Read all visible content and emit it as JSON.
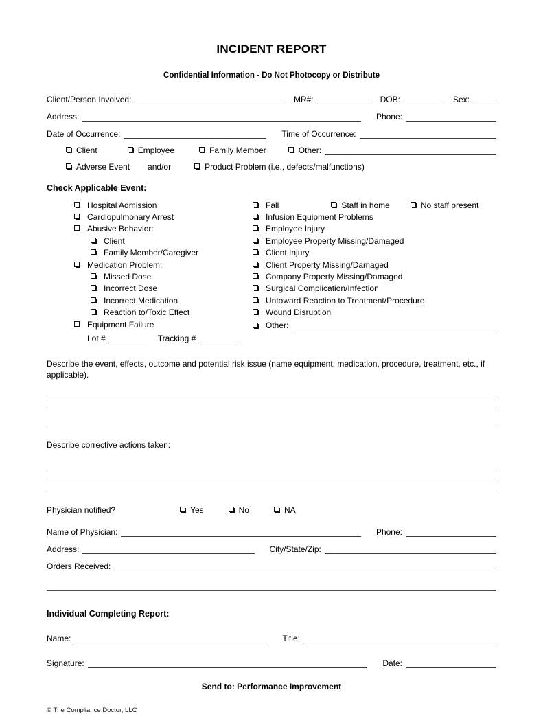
{
  "header": {
    "title": "INCIDENT REPORT",
    "subtitle": "Confidential Information - Do Not Photocopy or Distribute"
  },
  "identity": {
    "client_label": "Client/Person Involved:",
    "mr_label": "MR#:",
    "dob_label": "DOB:",
    "sex_label": "Sex:",
    "address_label": "Address:",
    "phone_label": "Phone:",
    "date_label": "Date of Occurrence:",
    "time_label": "Time of Occurrence:"
  },
  "person_type": {
    "row1": [
      "Client",
      "Employee",
      "Family Member"
    ],
    "other_label": "Other:",
    "row2_first": "Adverse Event",
    "conjunction": "and/or",
    "row2_second": "Product Problem (i.e., defects/malfunctions)"
  },
  "events": {
    "heading": "Check Applicable Event:",
    "left": [
      {
        "label": "Hospital Admission",
        "level": 0
      },
      {
        "label": "Cardiopulmonary Arrest",
        "level": 0
      },
      {
        "label": "Abusive Behavior:",
        "level": 0
      },
      {
        "label": "Client",
        "level": 1
      },
      {
        "label": "Family Member/Caregiver",
        "level": 1
      },
      {
        "label": "Medication Problem:",
        "level": 0
      },
      {
        "label": "Missed Dose",
        "level": 1
      },
      {
        "label": "Incorrect Dose",
        "level": 1
      },
      {
        "label": "Incorrect Medication",
        "level": 1
      },
      {
        "label": "Reaction to/Toxic Effect",
        "level": 1
      },
      {
        "label": "Equipment Failure",
        "level": 0
      }
    ],
    "lot_label": "Lot #",
    "tracking_label": "Tracking #",
    "right": [
      "Fall",
      "Infusion Equipment Problems",
      "Employee Injury",
      "Employee Property Missing/Damaged",
      "Client Injury",
      "Client Property Missing/Damaged",
      "Company Property Missing/Damaged",
      "Surgical Complication/Infection",
      "Untoward Reaction to Treatment/Procedure",
      "Wound Disruption"
    ],
    "fall_extra": [
      "Staff in home",
      "No staff present"
    ],
    "right_other_label": "Other:"
  },
  "narrative": {
    "describe_event": "Describe the event, effects, outcome and potential risk issue (name equipment, medication, procedure, treatment, etc., if applicable).",
    "describe_corrective": "Describe corrective actions taken:",
    "event_line_count": 3,
    "corrective_line_count": 3
  },
  "physician": {
    "notified_label": "Physician notified?",
    "options": [
      "Yes",
      "No",
      "NA"
    ],
    "name_label": "Name of Physician:",
    "phone_label": "Phone:",
    "address_label": "Address:",
    "city_label": "City/State/Zip:",
    "orders_label": "Orders Received:"
  },
  "completing": {
    "heading": "Individual Completing Report:",
    "name_label": "Name:",
    "title_label": "Title:",
    "signature_label": "Signature:",
    "date_label": "Date:"
  },
  "footer": {
    "send_to": "Send to:  Performance Improvement",
    "copyright": "© The Compliance Doctor, LLC"
  }
}
